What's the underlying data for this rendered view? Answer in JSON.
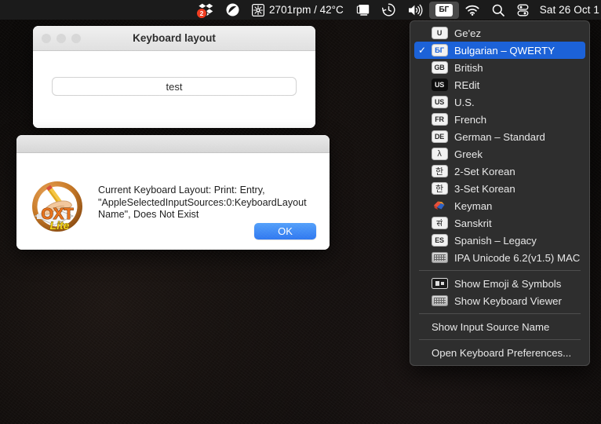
{
  "menubar": {
    "items": [
      {
        "name": "dropbox",
        "icon": "dropbox-icon",
        "badge": "2"
      },
      {
        "name": "do-not-disturb",
        "icon": "do-not-disturb-icon"
      },
      {
        "name": "fan-speed",
        "icon": "fan-icon",
        "label": "2701rpm / 42°C"
      },
      {
        "name": "display",
        "icon": "display-icon"
      },
      {
        "name": "time-machine",
        "icon": "clock-history-icon"
      },
      {
        "name": "volume",
        "icon": "speaker-icon"
      },
      {
        "name": "input-source",
        "icon": "keyboard-flag-icon",
        "label": "БГ",
        "active": true
      },
      {
        "name": "wifi",
        "icon": "wifi-icon"
      },
      {
        "name": "spotlight",
        "icon": "search-icon"
      },
      {
        "name": "control-center",
        "icon": "control-center-icon"
      }
    ],
    "clock": "Sat 26 Oct  1"
  },
  "keyboard_window": {
    "title": "Keyboard layout",
    "field_value": "test",
    "traffic_lights": [
      "close",
      "minimize",
      "zoom"
    ]
  },
  "alert": {
    "app_icon": "oxt-lite-icon",
    "icon_text_top": "OXT",
    "icon_text_bottom": "Lite",
    "message": "Current Keyboard Layout: Print: Entry, \"AppleSelectedInputSources:0:KeyboardLayout Name\", Does Not Exist",
    "ok_label": "OK"
  },
  "input_menu": {
    "sources": [
      {
        "label": "Ge'ez",
        "badge": "U",
        "badge_style": "light",
        "checked": false
      },
      {
        "label": "Bulgarian – QWERTY",
        "badge": "БГ",
        "badge_style": "cyr",
        "checked": true
      },
      {
        "label": "British",
        "badge": "GB",
        "badge_style": "light",
        "checked": false
      },
      {
        "label": "REdit",
        "badge": "US",
        "badge_style": "dark",
        "checked": false
      },
      {
        "label": "U.S.",
        "badge": "US",
        "badge_style": "light",
        "checked": false
      },
      {
        "label": "French",
        "badge": "FR",
        "badge_style": "light",
        "checked": false
      },
      {
        "label": "German – Standard",
        "badge": "DE",
        "badge_style": "light",
        "checked": false
      },
      {
        "label": "Greek",
        "badge": "λ",
        "badge_style": "big",
        "checked": false
      },
      {
        "label": "2-Set Korean",
        "badge": "한",
        "badge_style": "big",
        "checked": false
      },
      {
        "label": "3-Set Korean",
        "badge": "한",
        "badge_style": "big",
        "checked": false
      },
      {
        "label": "Keyman",
        "badge": "keyman-logo",
        "badge_style": "logo",
        "checked": false
      },
      {
        "label": "Sanskrit",
        "badge": "सं",
        "badge_style": "big",
        "checked": false
      },
      {
        "label": "Spanish – Legacy",
        "badge": "ES",
        "badge_style": "light",
        "checked": false
      },
      {
        "label": "IPA Unicode 6.2(v1.5) MAC",
        "badge": "keyboard",
        "badge_style": "keyboard",
        "checked": false
      }
    ],
    "viewers": [
      {
        "label": "Show Emoji & Symbols",
        "icon": "emoji-symbols-icon"
      },
      {
        "label": "Show Keyboard Viewer",
        "icon": "keyboard-viewer-icon"
      }
    ],
    "show_name_label": "Show Input Source Name",
    "preferences_label": "Open Keyboard Preferences...",
    "checkmark": "✓",
    "highlight_color": "#1c62d8"
  }
}
